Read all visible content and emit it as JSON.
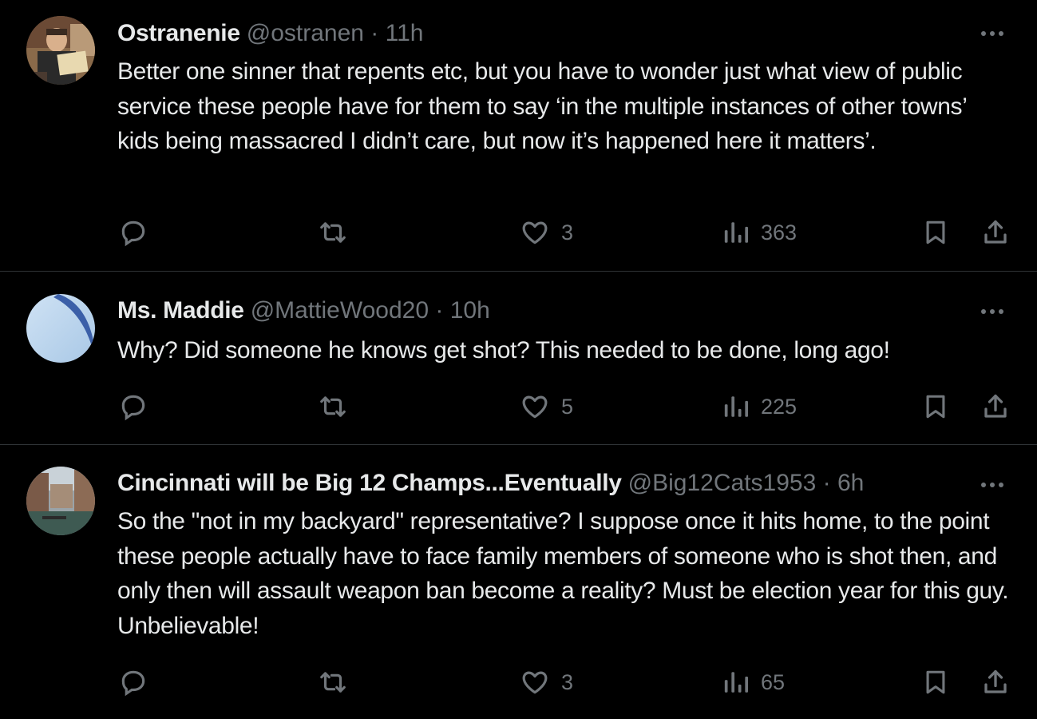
{
  "tweets": [
    {
      "name": "Ostranenie",
      "handle": "@ostranen",
      "separator": "·",
      "time": "11h",
      "text": "Better one sinner that repents etc, but you have to wonder just what view of public service these people have for them to say ‘in the multiple instances of other towns’ kids being massacred I didn’t care, but now it’s happened here it matters’.",
      "likes": "3",
      "views": "363"
    },
    {
      "name": "Ms. Maddie",
      "handle": "@MattieWood20",
      "separator": "·",
      "time": "10h",
      "text": "Why? Did someone he knows get shot? This needed to be done, long ago!",
      "likes": "5",
      "views": "225"
    },
    {
      "name": "Cincinnati will be Big 12 Champs...Eventually",
      "handle": "@Big12Cats1953",
      "separator": "·",
      "time": "6h",
      "text": "So the \"not in my backyard\" representative?  I suppose once it hits home, to the point these people actually have to face family members of someone who is shot then, and only then will assault weapon ban become a reality?  Must be election year for this guy.  Unbelievable!",
      "likes": "3",
      "views": "65"
    }
  ],
  "icons": {
    "reply": "reply-icon",
    "retweet": "retweet-icon",
    "like": "heart-icon",
    "views": "views-chart-icon",
    "bookmark": "bookmark-icon",
    "share": "share-icon",
    "more": "more-dots-icon"
  },
  "colors": {
    "background": "#000000",
    "text": "#e7e9ea",
    "secondary": "#71767b",
    "divider": "#2f3336"
  }
}
